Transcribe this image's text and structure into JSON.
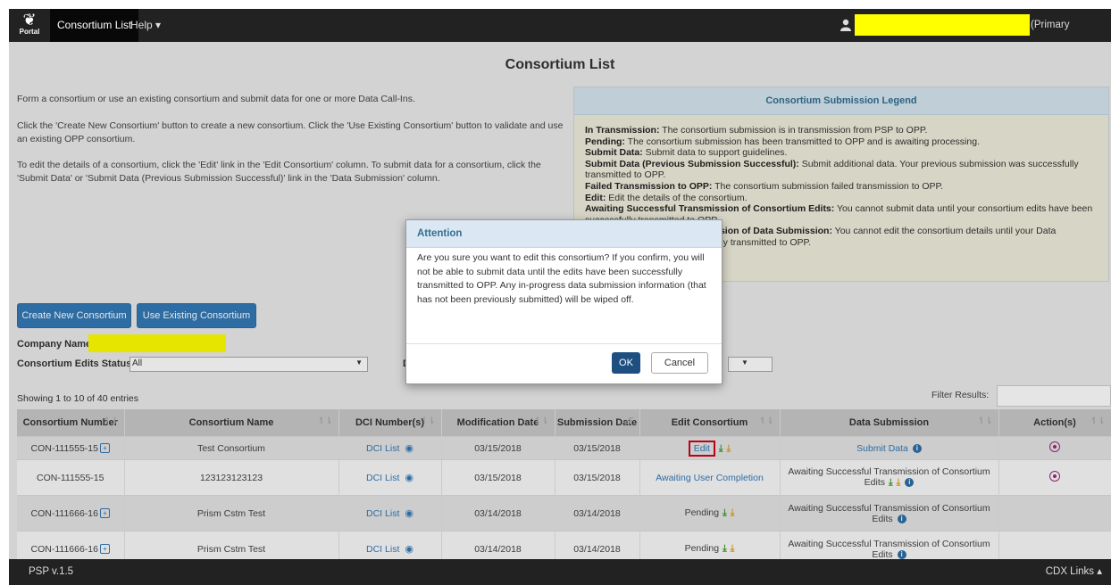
{
  "navbar": {
    "logo_text": "Portal",
    "items": [
      {
        "label": "Consortium List"
      },
      {
        "label": "Help ▾"
      }
    ],
    "user_role": "(Primary Submitter)"
  },
  "page": {
    "title": "Consortium List",
    "intro": [
      "Form a consortium or use an existing consortium and submit data for one or more Data Call-Ins.",
      "Click the 'Create New Consortium' button to create a new consortium. Click the 'Use Existing Consortium' button to validate and use an existing OPP consortium.",
      "To edit the details of a consortium, click the 'Edit' link in the 'Edit Consortium' column. To submit data for a consortium, click the 'Submit Data' or 'Submit Data (Previous Submission Successful)' link in the 'Data Submission' column."
    ]
  },
  "legend": {
    "title": "Consortium Submission Legend",
    "entries": [
      {
        "term": "In Transmission:",
        "desc": " The consortium submission is in transmission from PSP to OPP."
      },
      {
        "term": "Pending:",
        "desc": " The consortium submission has been transmitted to OPP and is awaiting processing."
      },
      {
        "term": "Submit Data:",
        "desc": " Submit data to support guidelines."
      },
      {
        "term": "Submit Data (Previous Submission Successful):",
        "desc": " Submit additional data. Your previous submission was successfully transmitted to OPP."
      },
      {
        "term": "Failed Transmission to OPP:",
        "desc": " The consortium submission failed transmission to OPP."
      },
      {
        "term": "Edit:",
        "desc": " Edit the details of the consortium."
      },
      {
        "term": "Awaiting Successful Transmission of Consortium Edits:",
        "desc": " You cannot submit data until your consortium edits have been successfully transmitted to OPP."
      },
      {
        "term": "Awaiting Successful Transmission of Data Submission:",
        "desc": " You cannot edit the consortium details until your Data Submission has been successfully transmitted to OPP."
      }
    ]
  },
  "actions": {
    "create_label": "Create New Consortium",
    "use_label": "Use Existing Consortium"
  },
  "filters": {
    "company_label": "Company Name",
    "edits_status_label": "Consortium Edits Status",
    "edits_status_value": "All",
    "data_status_label_partial": "D"
  },
  "table": {
    "showing": "Showing 1 to 10 of 40 entries",
    "filter_label": "Filter Results:",
    "headers": [
      "Consortium Number",
      "Consortium Name",
      "DCI Number(s)",
      "Modification Date",
      "Submission Date",
      "Edit Consortium",
      "Data Submission",
      "Action(s)"
    ],
    "rows": [
      {
        "number": "CON-111555-15",
        "name": "Test Consortium",
        "dci": "DCI List",
        "mod": "03/15/2018",
        "sub": "03/15/2018",
        "edit": "Edit",
        "data": "Submit Data"
      },
      {
        "number": "CON-111555-15",
        "name": "123123123123",
        "dci": "DCI List",
        "mod": "03/15/2018",
        "sub": "03/15/2018",
        "edit": "Awaiting User Completion",
        "data": "Awaiting Successful Transmission of Consortium Edits"
      },
      {
        "number": "CON-111666-16",
        "name": "Prism Cstm Test",
        "dci": "DCI List",
        "mod": "03/14/2018",
        "sub": "03/14/2018",
        "edit": "Pending",
        "data": "Awaiting Successful Transmission of Consortium Edits"
      },
      {
        "number": "CON-111666-16",
        "name": "Prism Cstm Test",
        "dci": "DCI List",
        "mod": "03/14/2018",
        "sub": "03/14/2018",
        "edit": "Pending",
        "data": "Awaiting Successful Transmission of Consortium Edits"
      }
    ]
  },
  "modal": {
    "title": "Attention",
    "body": "Are you sure you want to edit this consortium? If you confirm, you will not be able to submit data until the edits have been successfully transmitted to OPP. Any in-progress data submission information (that has not been previously submitted) will be wiped off.",
    "ok_label": "OK",
    "cancel_label": "Cancel"
  },
  "footer": {
    "version": "PSP v.1.5",
    "links_label": "CDX Links ▴"
  },
  "colors": {
    "navbar": "#222222",
    "primary": "#337ab7",
    "highlight_redaction": "#ffff00",
    "edit_outline": "#d0021b"
  },
  "icons": [
    "portal-logo-icon",
    "user-icon",
    "expand-plus-icon",
    "eye-icon",
    "download-icon",
    "info-icon",
    "action-circle-icon",
    "sort-icon"
  ]
}
